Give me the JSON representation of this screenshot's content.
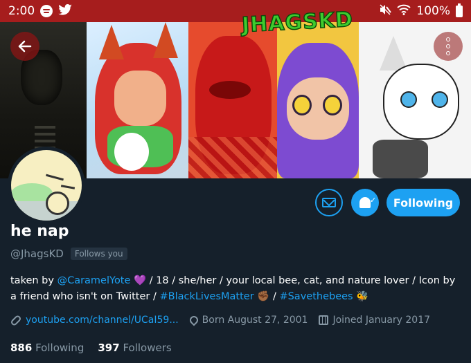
{
  "status_bar": {
    "time": "2:00",
    "battery": "100%",
    "icons": [
      "spotify-icon",
      "twitter-icon",
      "mute-icon",
      "wifi-icon",
      "battery-icon"
    ]
  },
  "banner": {
    "text": "JHAGSKD"
  },
  "profile": {
    "display_name": "he nap",
    "handle": "@JhagsKD",
    "follows_you": "Follows you",
    "following_label": "Following",
    "bio": {
      "taken_by": "taken by ",
      "mention": "@CaramelYote",
      "part2": " / 18 / she/her / your local bee, cat, and nature lover / Icon by a friend who isn't on Twitter / ",
      "hashtag1": "#BlackLivesMatter",
      "part3": " / ",
      "hashtag2": "#Savethebees",
      "emoji_heart": "💜",
      "emoji_fist": "✊🏾",
      "emoji_bee": "🐝"
    },
    "meta": {
      "website": "youtube.com/channel/UCaI59...",
      "born": "Born August 27, 2001",
      "joined": "Joined January 2017"
    },
    "counts": {
      "following_count": "886",
      "following_label": "Following",
      "followers_count": "397",
      "followers_label": "Followers"
    }
  },
  "colors": {
    "status_bar": "#a61d1d",
    "background": "#15202b",
    "accent": "#1da1f2",
    "muted": "#8899a6"
  }
}
